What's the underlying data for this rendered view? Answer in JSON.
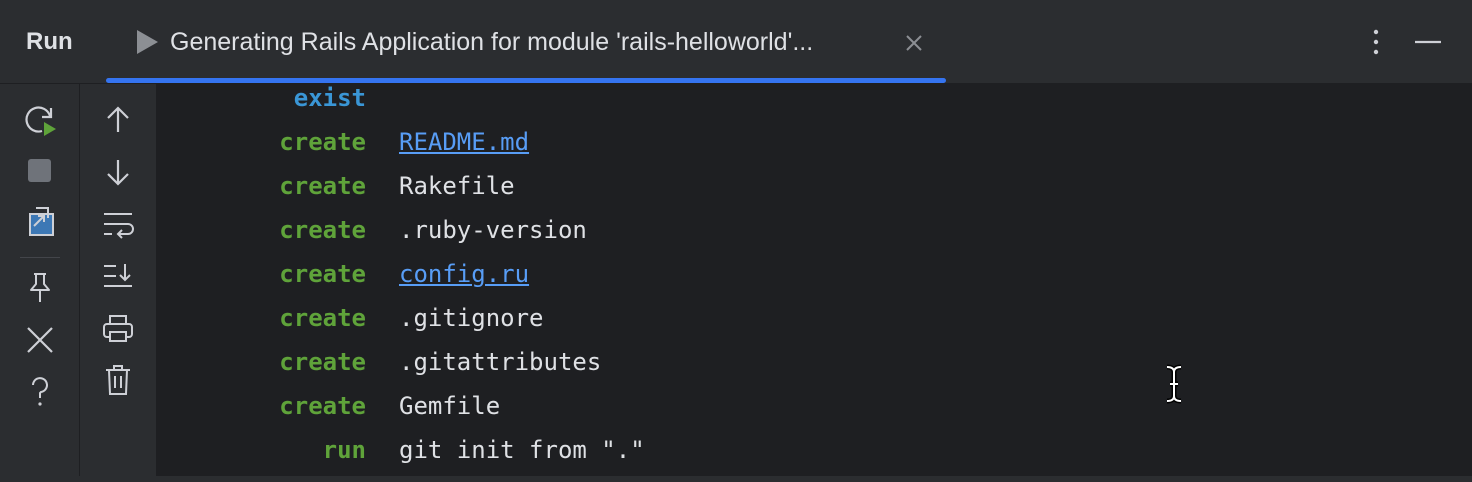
{
  "header": {
    "title": "Run",
    "tab": {
      "label": "Generating Rails Application for module 'rails-helloworld'...",
      "icon": "play-icon",
      "close_icon": "close-icon"
    },
    "more_icon": "more-vertical-icon",
    "minimize_icon": "minimize-icon"
  },
  "left_toolbar": {
    "items": [
      {
        "name": "rerun-icon"
      },
      {
        "name": "stop-icon"
      },
      {
        "name": "restore-layout-icon"
      },
      {
        "name": "pin-icon"
      },
      {
        "name": "close-icon"
      },
      {
        "name": "help-icon"
      }
    ]
  },
  "second_toolbar": {
    "items": [
      {
        "name": "arrow-up-icon"
      },
      {
        "name": "arrow-down-icon"
      },
      {
        "name": "soft-wrap-icon"
      },
      {
        "name": "scroll-to-end-icon"
      },
      {
        "name": "print-icon"
      },
      {
        "name": "clear-icon"
      }
    ]
  },
  "console": {
    "lines": [
      {
        "verb": "exist",
        "target": ""
      },
      {
        "verb": "create",
        "target": "README.md",
        "link": true
      },
      {
        "verb": "create",
        "target": "Rakefile"
      },
      {
        "verb": "create",
        "target": ".ruby-version"
      },
      {
        "verb": "create",
        "target": "config.ru",
        "link": true
      },
      {
        "verb": "create",
        "target": ".gitignore"
      },
      {
        "verb": "create",
        "target": ".gitattributes"
      },
      {
        "verb": "create",
        "target": "Gemfile"
      },
      {
        "verb": "run",
        "target": "git init from \".\""
      }
    ]
  },
  "colors": {
    "accent": "#3574f0",
    "create": "#5fa33a",
    "exist": "#3a96d6",
    "link": "#589df6",
    "background": "#1e1f22",
    "panel": "#2b2d30"
  }
}
